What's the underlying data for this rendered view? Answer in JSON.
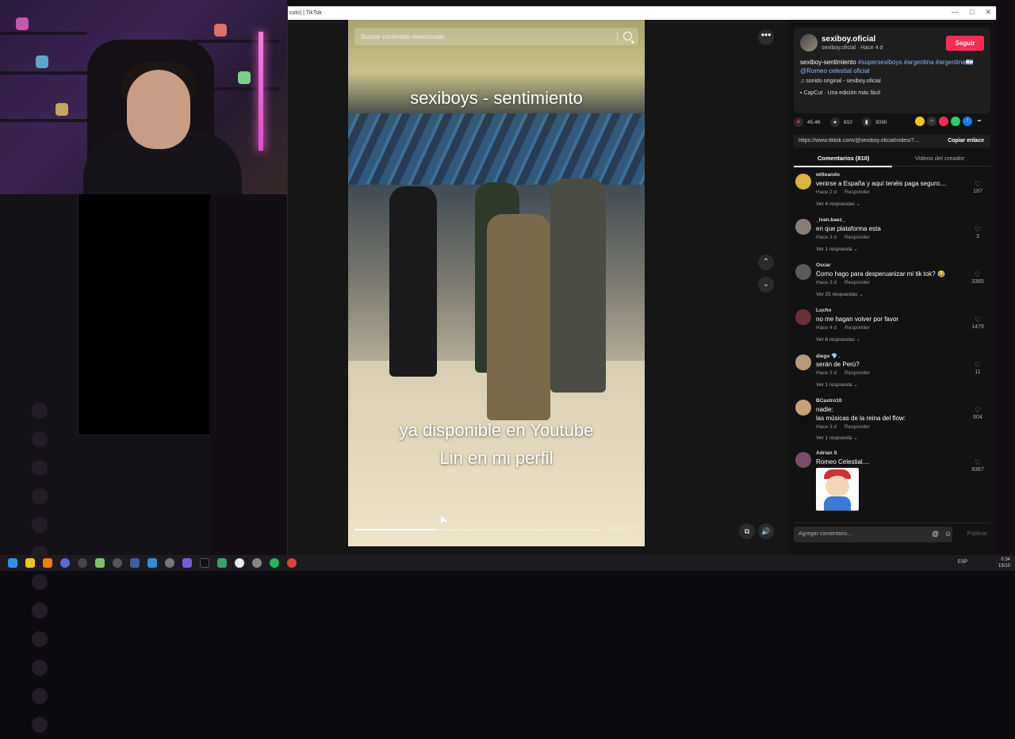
{
  "window": {
    "title": "colo) | TikTok",
    "controls": [
      "—",
      "□",
      "✕"
    ]
  },
  "video": {
    "search_placeholder": "Buscar contenido relacionado",
    "caption_top": "sexiboys - sentimiento",
    "caption_bottom_line1": "ya disponible en Youtube",
    "caption_bottom_line2": "Lin en mi perfil",
    "time": "00:21/01:07",
    "progress": 0.33
  },
  "controls": {
    "more_icon": "•••",
    "up_icon": "⌃",
    "down_icon": "⌄",
    "pip_icon": "⧉",
    "volume_icon": "🔊"
  },
  "profile": {
    "username": "sexiboy.oficial",
    "subtitle": "sexiboy.oficial · Hace 4 d",
    "follow_label": "Seguir",
    "description_text": "sexiboy-sentimiento ",
    "tag1": "#supersexiboys",
    "tag2": "#argentina",
    "tag3": "#argentina",
    "flag": "🇦🇷",
    "mention": "@Romeo celestial oficial",
    "music": "sonido original - sexiboy.oficial",
    "capcut": "CapCut · Una edición más fácil"
  },
  "stats": {
    "likes": "45.4K",
    "comments": "810",
    "saves": "3030"
  },
  "share": {
    "url": "https://www.tiktok.com/@sexiboy.oficial/video/7...",
    "copy_label": "Copiar enlace"
  },
  "tabs": {
    "comments_label": "Comentarios (810)",
    "creator_label": "Videos del creador"
  },
  "comments": [
    {
      "user": "wilteando",
      "text": "venirse a España y aquí tenéis paga seguro....",
      "time": "Hace 2 d",
      "reply": "Responder",
      "replies": "Ver 4 respuestas ⌄",
      "likes": "187",
      "color": "#d9b33a"
    },
    {
      "user": "_ivan.baez_",
      "text": "en que plataforma esta",
      "time": "Hace 3 d",
      "reply": "Responder",
      "replies": "Ver 1 respuesta ⌄",
      "likes": "3",
      "color": "#8a7d78"
    },
    {
      "user": "Oscar",
      "text": "Como hago para desperuanizar mi tik tok? 😂",
      "time": "Hace 3 d",
      "reply": "Responder",
      "replies": "Ver 25 respuestas ⌄",
      "likes": "3385",
      "color": "#5a5a5a"
    },
    {
      "user": "Lucho",
      "text": "no me hagan volver por favor",
      "time": "Hace 4 d",
      "reply": "Responder",
      "replies": "Ver 8 respuestas ⌄",
      "likes": "1479",
      "color": "#6b2f3a"
    },
    {
      "user": "diego 💎 .",
      "text": "serán de Perú?",
      "time": "Hace 2 d",
      "reply": "Responder",
      "replies": "Ver 1 respuesta ⌄",
      "likes": "11",
      "color": "#b69a7a"
    },
    {
      "user": "BCastro10",
      "text": "nadie:",
      "text2": "las músicas de la reina del flow:",
      "time": "Hace 3 d",
      "reply": "Responder",
      "replies": "Ver 1 respuesta ⌄",
      "likes": "604",
      "color": "#caa070"
    },
    {
      "user": "Adrian S",
      "text": "Romeo Celestial....",
      "likes": "8367",
      "color": "#7a4d6a"
    }
  ],
  "comment_input": {
    "placeholder": "Agregar comentario...",
    "post_label": "Publicar"
  },
  "taskbar": {
    "lang": "ESP",
    "time": "0:34",
    "date": "15/10"
  }
}
